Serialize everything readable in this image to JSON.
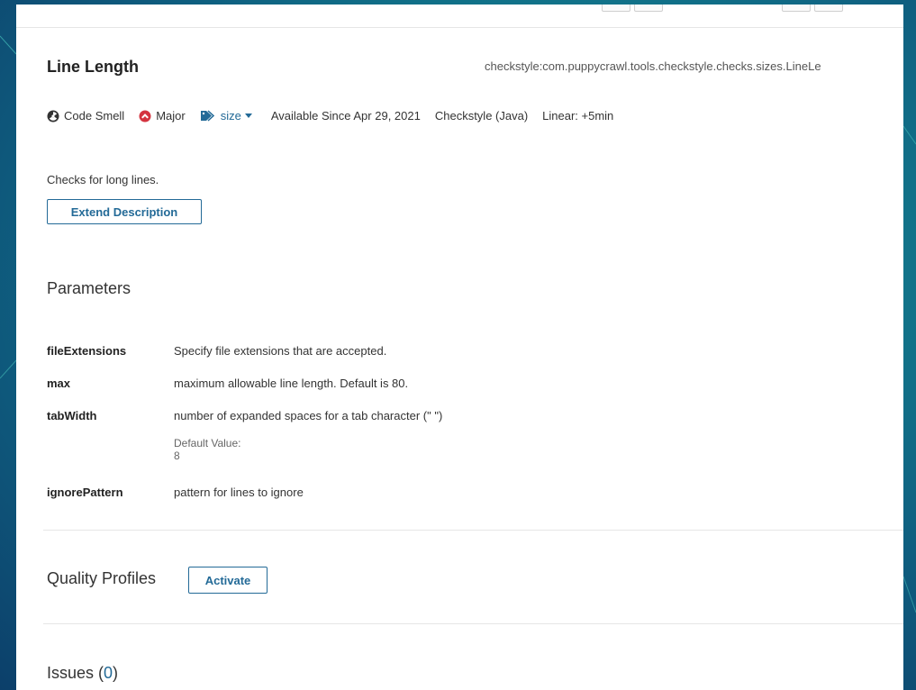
{
  "rule": {
    "title": "Line Length",
    "key": "checkstyle:com.puppycrawl.tools.checkstyle.checks.sizes.LineLe"
  },
  "meta": {
    "type": "Code Smell",
    "severity": "Major",
    "tag": "size",
    "available_since": "Available Since Apr 29, 2021",
    "repository": "Checkstyle (Java)",
    "remediation": "Linear: +5min"
  },
  "description": {
    "text": "Checks for long lines.",
    "extend_label": "Extend Description"
  },
  "parameters": {
    "title": "Parameters",
    "items": [
      {
        "name": "fileExtensions",
        "description": "Specify file extensions that are accepted."
      },
      {
        "name": "max",
        "description": "maximum allowable line length. Default is 80."
      },
      {
        "name": "tabWidth",
        "description": "number of expanded spaces for a tab character (\" \")",
        "default_label": "Default Value:",
        "default_value": "8"
      },
      {
        "name": "ignorePattern",
        "description": "pattern for lines to ignore"
      }
    ]
  },
  "quality_profiles": {
    "title": "Quality Profiles",
    "activate_label": "Activate"
  },
  "issues": {
    "title": "Issues (",
    "count": "0",
    "close": ")"
  },
  "colors": {
    "accent": "#236a97",
    "severity_major": "#d4333f"
  }
}
